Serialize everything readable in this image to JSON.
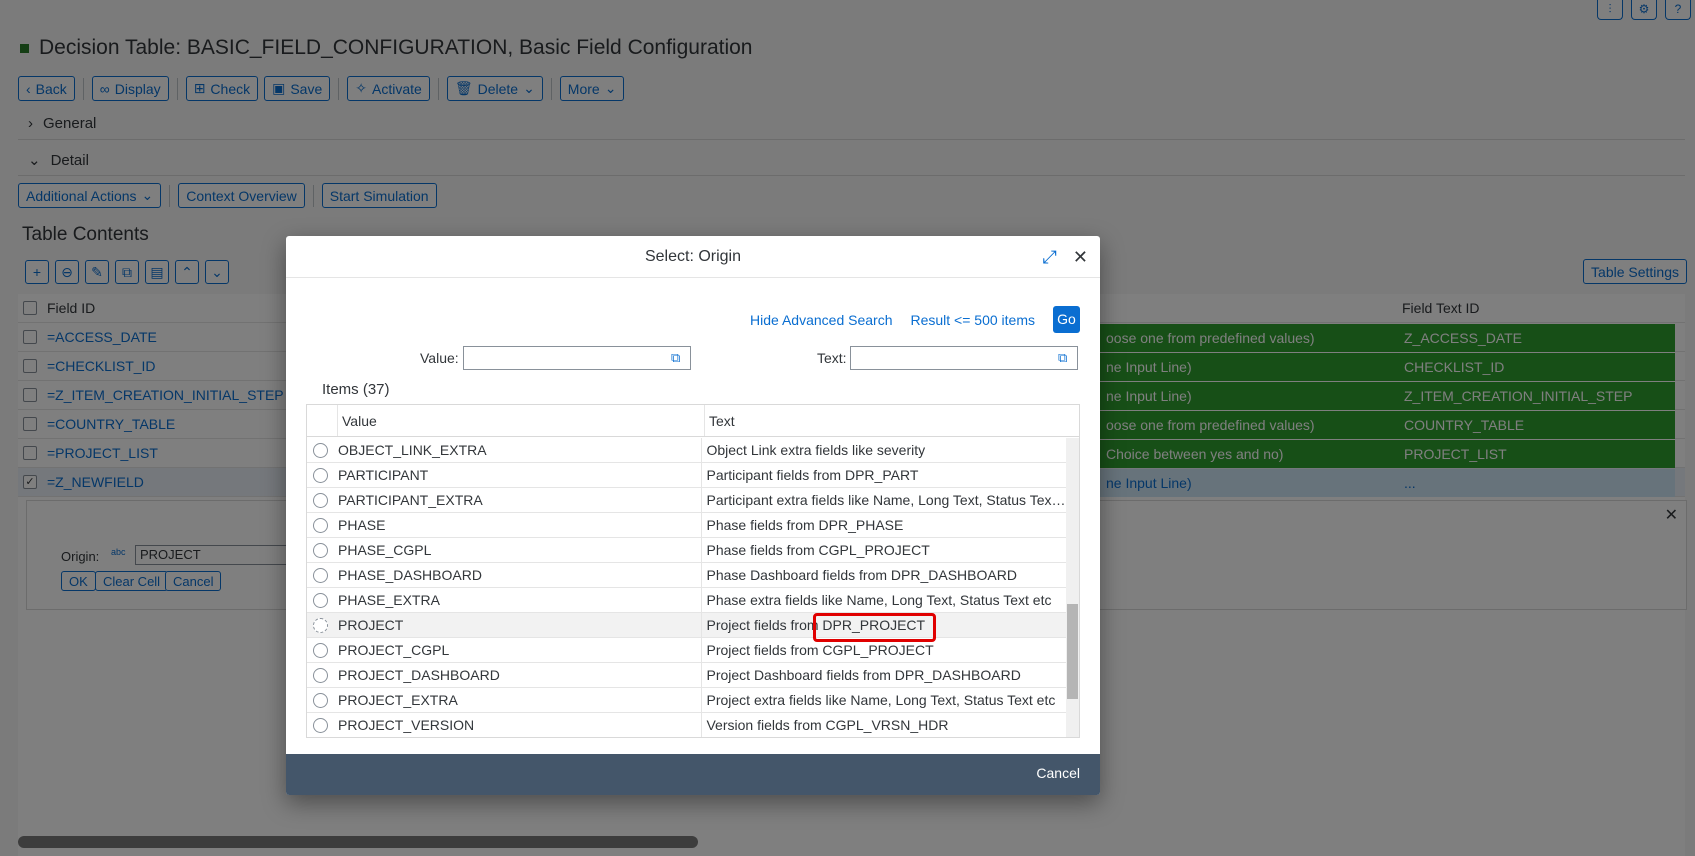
{
  "page": {
    "title": "Decision Table: BASIC_FIELD_CONFIGURATION, Basic Field Configuration",
    "toolbar": [
      "Back",
      "Display",
      "Check",
      "Save",
      "Activate",
      "Delete",
      "More"
    ],
    "sections": {
      "general": "General",
      "detail": "Detail"
    },
    "actions": [
      "Additional Actions",
      "Context Overview",
      "Start Simulation"
    ],
    "table_contents_title": "Table Contents",
    "table_settings": "Table Settings",
    "columns": {
      "field_id": "Field ID",
      "field_text_id": "Field Text ID"
    },
    "rows": [
      {
        "field_id": "=ACCESS_DATE",
        "mid": "oose one from predefined values)",
        "text_id": "Z_ACCESS_DATE"
      },
      {
        "field_id": "=CHECKLIST_ID",
        "mid": "ne Input Line)",
        "text_id": "CHECKLIST_ID"
      },
      {
        "field_id": "=Z_ITEM_CREATION_INITIAL_STEP",
        "mid": "ne Input Line)",
        "text_id": "Z_ITEM_CREATION_INITIAL_STEP"
      },
      {
        "field_id": "=COUNTRY_TABLE",
        "mid": "oose one from predefined values)",
        "text_id": "COUNTRY_TABLE"
      },
      {
        "field_id": "=PROJECT_LIST",
        "mid": "Choice between yes and no)",
        "text_id": "PROJECT_LIST"
      },
      {
        "field_id": "=Z_NEWFIELD",
        "mid": "ne Input Line)",
        "text_id": "..."
      }
    ],
    "edit_panel": {
      "origin_label": "Origin:",
      "origin_value": "PROJECT",
      "ok": "OK",
      "clear_cell": "Clear Cell",
      "cancel": "Cancel"
    }
  },
  "dialog": {
    "title": "Select: Origin",
    "hide_advanced_search": "Hide Advanced Search",
    "result_limit": "Result <= 500 items",
    "go": "Go",
    "value_label": "Value:",
    "text_label": "Text:",
    "items_title": "Items (37)",
    "col_value": "Value",
    "col_text": "Text",
    "items": [
      {
        "value": "OBJECT_LINK_EXTRA",
        "text": "Object Link extra fields like severity"
      },
      {
        "value": "PARTICIPANT",
        "text": "Participant fields from DPR_PART"
      },
      {
        "value": "PARTICIPANT_EXTRA",
        "text": "Participant extra fields like Name, Long Text, Status Text..."
      },
      {
        "value": "PHASE",
        "text": "Phase fields from DPR_PHASE"
      },
      {
        "value": "PHASE_CGPL",
        "text": "Phase fields from CGPL_PROJECT"
      },
      {
        "value": "PHASE_DASHBOARD",
        "text": "Phase Dashboard fields from DPR_DASHBOARD"
      },
      {
        "value": "PHASE_EXTRA",
        "text": "Phase extra fields like Name, Long Text, Status Text etc"
      },
      {
        "value": "PROJECT",
        "text": "Project fields from DPR_PROJECT",
        "selected": true
      },
      {
        "value": "PROJECT_CGPL",
        "text": "Project fields from CGPL_PROJECT"
      },
      {
        "value": "PROJECT_DASHBOARD",
        "text": "Project Dashboard fields from DPR_DASHBOARD"
      },
      {
        "value": "PROJECT_EXTRA",
        "text": "Project extra fields like Name, Long Text, Status Text etc"
      },
      {
        "value": "PROJECT_VERSION",
        "text": "Version fields from CGPL_VRSN_HDR"
      }
    ],
    "cancel": "Cancel"
  },
  "colors": {
    "accent": "#0a6ed1",
    "footer": "#44566a",
    "green": "#2f9e2f",
    "highlight": "#e00000"
  }
}
